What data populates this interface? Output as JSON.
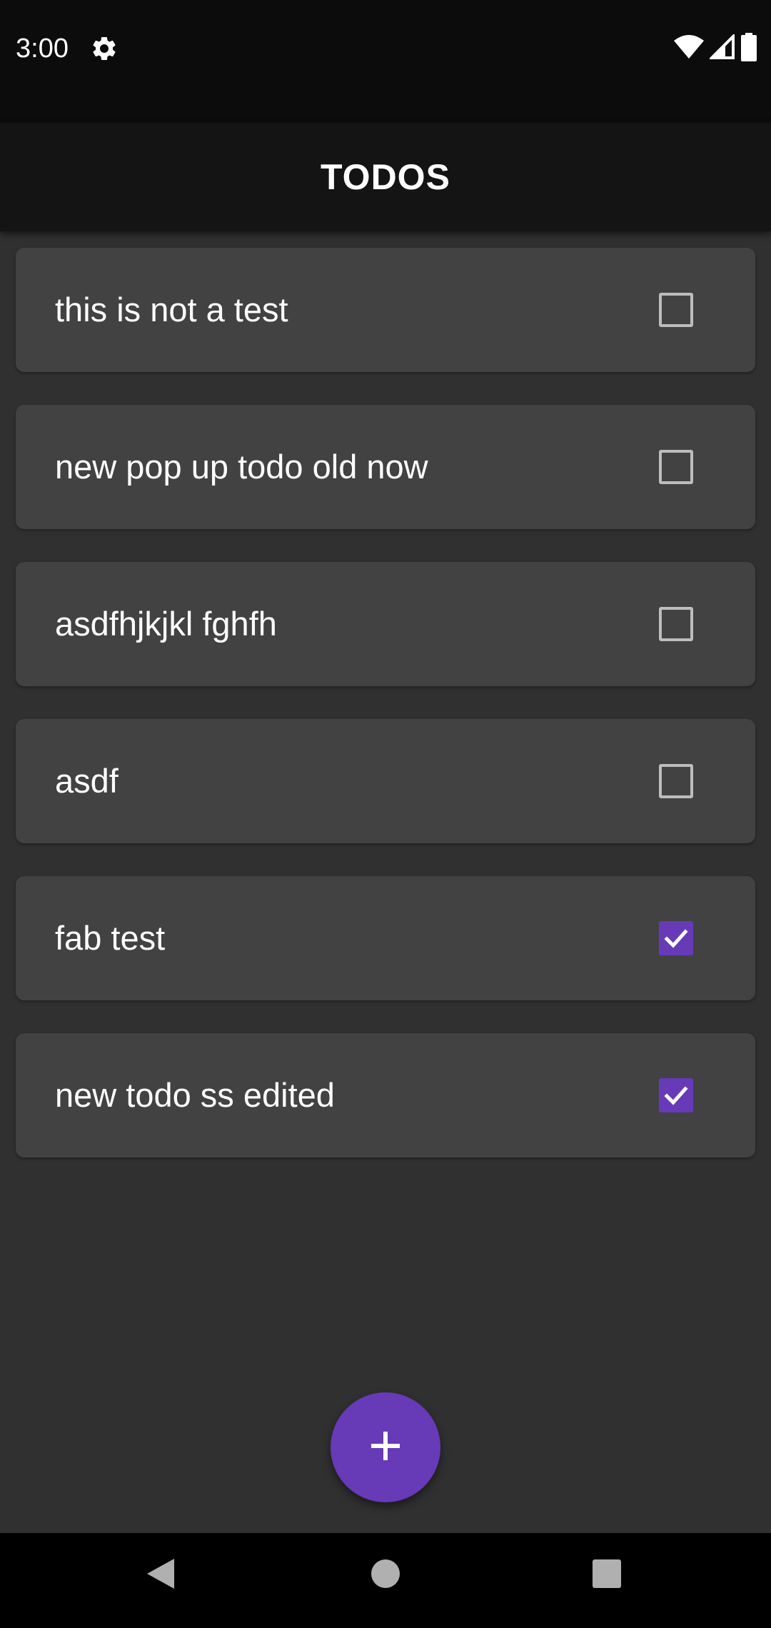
{
  "status_bar": {
    "time": "3:00",
    "icons": [
      "gear-icon",
      "wifi-icon",
      "cell-signal-icon",
      "battery-icon"
    ]
  },
  "app_bar": {
    "title": "TODOS"
  },
  "todos": [
    {
      "text": "this is not a test",
      "done": false
    },
    {
      "text": "new pop up todo old now",
      "done": false
    },
    {
      "text": "asdfhjkjkl fghfh",
      "done": false
    },
    {
      "text": "asdf",
      "done": false
    },
    {
      "text": "fab test",
      "done": true
    },
    {
      "text": "new todo ss edited",
      "done": true
    }
  ],
  "fab": {
    "icon": "plus-icon"
  },
  "nav_bar": {
    "icons": [
      "back-icon",
      "home-icon",
      "recents-icon"
    ]
  },
  "colors": {
    "background": "#303030",
    "card": "#424242",
    "app_bar": "#141414",
    "accent": "#673ab7",
    "checkbox_border": "#bdbdbd",
    "text": "#ffffff"
  }
}
